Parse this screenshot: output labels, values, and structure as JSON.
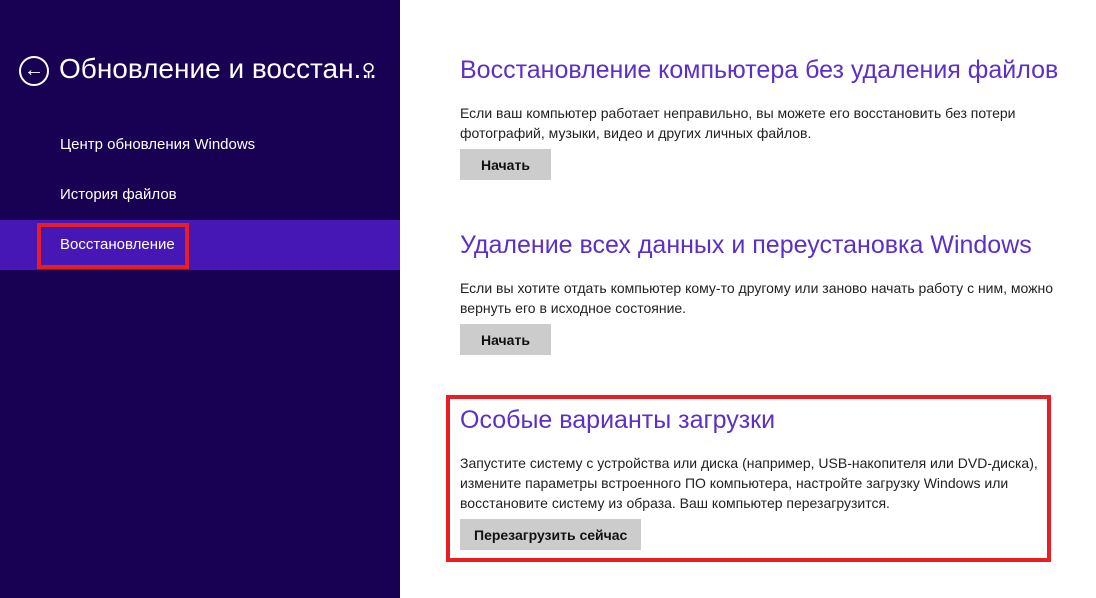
{
  "sidebar": {
    "title": "Обновление и восстан...",
    "back_icon": "arrow-left-circle",
    "search_icon": "magnifier",
    "items": [
      {
        "label": "Центр обновления Windows"
      },
      {
        "label": "История файлов"
      },
      {
        "label": "Восстановление",
        "selected": true
      }
    ]
  },
  "sections": [
    {
      "title": "Восстановление компьютера без удаления файлов",
      "lines": [
        "Если ваш компьютер работает неправильно, вы можете его восстановить без потери",
        "фотографий, музыки, видео и других личных файлов."
      ],
      "button": "Начать"
    },
    {
      "title": "Удаление всех данных и переустановка Windows",
      "lines": [
        "Если вы хотите отдать компьютер кому-то другому или заново начать работу с ним, можно",
        "вернуть его в исходное состояние."
      ],
      "button": "Начать"
    },
    {
      "title": "Особые варианты загрузки",
      "lines": [
        "Запустите систему с устройства или диска (например, USB-накопителя или DVD-диска),",
        "измените параметры встроенного ПО компьютера, настройте загрузку Windows или",
        "восстановите систему из образа. Ваш компьютер перезагрузится."
      ],
      "button": "Перезагрузить сейчас"
    }
  ],
  "colors": {
    "sidebar": "#180052",
    "selected": "#4617b4",
    "accent": "#5b2fc9",
    "highlight": "#e81d25"
  }
}
